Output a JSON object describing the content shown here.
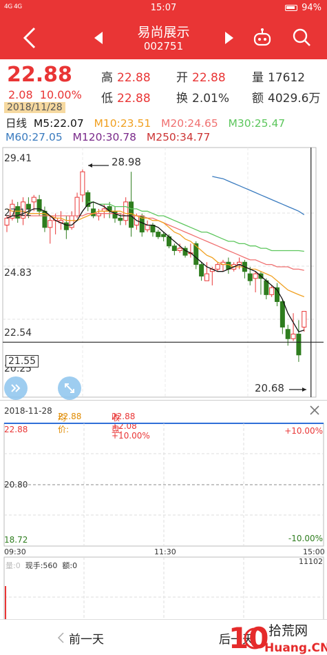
{
  "status": {
    "signal": "4G 4G",
    "time": "15:07",
    "battery": "94%"
  },
  "nav": {
    "title": "易尚展示",
    "code": "002751"
  },
  "quote": {
    "price": "22.88",
    "change": "2.08",
    "change_pct": "10.00%",
    "date": "2018/11/28",
    "high_label": "高",
    "high": "22.88",
    "open_label": "开",
    "open": "22.88",
    "vol_label": "量",
    "vol": "17612",
    "low_label": "低",
    "low": "22.88",
    "turnover_label": "换",
    "turnover": "2.01%",
    "amount_label": "额",
    "amount": "4029.6万"
  },
  "ma": {
    "period": "日线",
    "m5": "M5:22.07",
    "m10": "M10:23.51",
    "m20": "M20:24.65",
    "m30": "M30:25.47",
    "m60": "M60:27.05",
    "m120": "M120:30.78",
    "m250": "M250:34.77"
  },
  "colors": {
    "up": "#e93535",
    "down": "#2e7d1e",
    "m5": "#111111",
    "m10": "#f0a020",
    "m20": "#f07070",
    "m30": "#5cc65c",
    "m60": "#3a7bbf",
    "m120": "#7a2a8a",
    "m250": "#cc3333"
  },
  "kline": {
    "y_labels": [
      "29.41",
      "27.12",
      "24.83",
      "22.54",
      "20.25"
    ],
    "crosshair_value": "21.55",
    "max_label": "28.98",
    "min_label": "20.68",
    "candles": [
      [
        26.6,
        26.9,
        26.3,
        27.0
      ],
      [
        26.9,
        27.5,
        26.8,
        27.7
      ],
      [
        27.4,
        26.9,
        26.7,
        27.6
      ],
      [
        26.9,
        27.6,
        26.6,
        27.8
      ],
      [
        27.5,
        27.3,
        26.9,
        27.8
      ],
      [
        27.6,
        27.8,
        27.2,
        27.9
      ],
      [
        27.7,
        27.2,
        27.0,
        27.9
      ],
      [
        27.2,
        26.5,
        26.3,
        27.4
      ],
      [
        26.5,
        26.8,
        25.8,
        27.0
      ],
      [
        26.8,
        26.9,
        26.2,
        27.1
      ],
      [
        26.7,
        26.8,
        26.4,
        27.2
      ],
      [
        26.7,
        26.4,
        26.0,
        27.0
      ],
      [
        26.5,
        27.0,
        26.4,
        27.2
      ],
      [
        27.0,
        27.8,
        26.9,
        28.0
      ],
      [
        27.9,
        28.9,
        27.6,
        29.0
      ],
      [
        28.0,
        27.4,
        27.2,
        28.1
      ],
      [
        27.3,
        27.0,
        26.9,
        27.6
      ],
      [
        27.0,
        27.1,
        26.8,
        27.3
      ],
      [
        27.2,
        27.3,
        26.9,
        27.5
      ],
      [
        27.4,
        27.2,
        26.9,
        27.6
      ],
      [
        27.2,
        26.9,
        26.7,
        27.4
      ],
      [
        26.9,
        26.8,
        26.6,
        27.1
      ],
      [
        26.8,
        27.6,
        26.6,
        27.8
      ],
      [
        27.6,
        26.5,
        26.1,
        28.9
      ],
      [
        26.6,
        27.0,
        26.4,
        27.1
      ],
      [
        27.0,
        26.3,
        26.1,
        27.1
      ],
      [
        26.4,
        26.6,
        26.3,
        26.8
      ],
      [
        26.6,
        26.3,
        26.1,
        26.7
      ],
      [
        26.3,
        26.1,
        26.0,
        26.4
      ],
      [
        26.2,
        26.1,
        25.9,
        26.3
      ],
      [
        26.1,
        25.7,
        25.6,
        26.2
      ],
      [
        25.7,
        25.5,
        25.3,
        25.8
      ],
      [
        25.5,
        25.6,
        25.4,
        25.8
      ],
      [
        25.6,
        25.3,
        25.2,
        25.7
      ],
      [
        25.4,
        25.4,
        25.2,
        25.8
      ],
      [
        25.8,
        24.9,
        24.7,
        25.9
      ],
      [
        24.9,
        24.4,
        24.2,
        25.0
      ],
      [
        24.2,
        24.5,
        24.3,
        25.0
      ],
      [
        24.6,
        24.7,
        24.0,
        24.8
      ],
      [
        24.7,
        24.9,
        24.6,
        25.0
      ],
      [
        24.9,
        25.0,
        24.6,
        25.1
      ],
      [
        25.0,
        24.7,
        24.5,
        25.2
      ],
      [
        24.7,
        24.9,
        24.6,
        25.0
      ],
      [
        24.9,
        25.0,
        24.7,
        25.2
      ],
      [
        25.0,
        24.6,
        24.3,
        25.1
      ],
      [
        24.5,
        24.2,
        24.0,
        24.8
      ],
      [
        24.3,
        24.5,
        23.7,
        24.6
      ],
      [
        24.5,
        24.3,
        23.6,
        24.6
      ],
      [
        24.2,
        23.6,
        23.4,
        24.3
      ],
      [
        23.6,
        23.9,
        23.5,
        24.0
      ],
      [
        23.9,
        23.3,
        23.1,
        24.1
      ],
      [
        23.3,
        22.2,
        21.9,
        23.4
      ],
      [
        22.1,
        21.7,
        21.4,
        22.3
      ],
      [
        21.7,
        21.9,
        21.6,
        22.8
      ],
      [
        21.9,
        21.0,
        20.7,
        22.5
      ],
      [
        22.2,
        22.88,
        22.0,
        22.88
      ]
    ],
    "ma5": [
      26.9,
      27.0,
      27.0,
      27.1,
      27.2,
      27.3,
      27.3,
      27.2,
      27.0,
      26.8,
      26.7,
      26.6,
      26.6,
      26.8,
      27.2,
      27.5,
      27.6,
      27.5,
      27.4,
      27.2,
      27.1,
      27.0,
      27.0,
      27.0,
      26.8,
      26.7,
      26.6,
      26.6,
      26.5,
      26.3,
      26.1,
      25.9,
      25.7,
      25.5,
      25.4,
      25.2,
      25.0,
      24.8,
      24.7,
      24.6,
      24.6,
      24.7,
      24.8,
      24.9,
      24.8,
      24.7,
      24.6,
      24.4,
      24.2,
      24.0,
      23.8,
      23.4,
      22.8,
      22.4,
      22.0,
      22.07
    ],
    "ma10": [
      27.3,
      27.2,
      27.2,
      27.2,
      27.1,
      27.1,
      27.1,
      27.1,
      27.0,
      26.9,
      26.9,
      26.8,
      26.8,
      26.8,
      26.9,
      27.0,
      27.1,
      27.2,
      27.2,
      27.2,
      27.2,
      27.2,
      27.1,
      27.1,
      27.0,
      26.9,
      26.9,
      26.8,
      26.8,
      26.7,
      26.5,
      26.3,
      26.2,
      26.0,
      25.9,
      25.7,
      25.5,
      25.3,
      25.2,
      25.0,
      24.9,
      24.9,
      24.8,
      24.8,
      24.8,
      24.7,
      24.7,
      24.6,
      24.5,
      24.4,
      24.2,
      24.0,
      23.8,
      23.7,
      23.6,
      23.51
    ],
    "ma20": [
      27.0,
      27.0,
      27.0,
      27.0,
      27.0,
      27.0,
      27.0,
      27.0,
      27.0,
      27.0,
      27.0,
      27.0,
      27.0,
      27.0,
      27.0,
      27.1,
      27.1,
      27.1,
      27.1,
      27.1,
      27.1,
      27.1,
      27.0,
      27.0,
      27.0,
      27.0,
      26.9,
      26.9,
      26.8,
      26.7,
      26.6,
      26.5,
      26.4,
      26.3,
      26.2,
      26.1,
      26.0,
      25.9,
      25.8,
      25.7,
      25.6,
      25.5,
      25.4,
      25.3,
      25.2,
      25.1,
      25.1,
      25.0,
      24.9,
      24.9,
      24.8,
      24.8,
      24.8,
      24.7,
      24.7,
      24.65
    ],
    "ma30": [
      null,
      null,
      null,
      null,
      null,
      null,
      null,
      null,
      null,
      null,
      null,
      null,
      null,
      null,
      null,
      27.6,
      27.6,
      27.5,
      27.5,
      27.5,
      27.4,
      27.4,
      27.4,
      27.3,
      27.3,
      27.2,
      27.2,
      27.1,
      27.0,
      27.0,
      26.9,
      26.8,
      26.7,
      26.6,
      26.5,
      26.4,
      26.3,
      26.3,
      26.2,
      26.1,
      26.0,
      25.9,
      25.9,
      25.8,
      25.8,
      25.7,
      25.7,
      25.6,
      25.6,
      25.5,
      25.5,
      25.5,
      25.5,
      25.5,
      25.5,
      25.47
    ],
    "ma60": [
      null,
      null,
      null,
      null,
      null,
      null,
      null,
      null,
      null,
      null,
      null,
      null,
      null,
      null,
      null,
      null,
      null,
      null,
      null,
      null,
      null,
      null,
      null,
      null,
      null,
      null,
      null,
      null,
      null,
      null,
      null,
      null,
      null,
      null,
      null,
      null,
      null,
      null,
      28.7,
      28.65,
      28.6,
      28.5,
      28.4,
      28.3,
      28.2,
      28.1,
      28.0,
      27.9,
      27.8,
      27.7,
      27.6,
      27.5,
      27.4,
      27.3,
      27.2,
      27.05
    ]
  },
  "intraday": {
    "date": "2018-11-28",
    "avg_label": "均价:",
    "avg": "22.88",
    "close_label": "收盘:",
    "close_info": "22.88 +2.08 +10.00%",
    "top_price": "22.88",
    "mid_price": "20.80",
    "bottom_price": "18.72",
    "top_pct": "+10.00%",
    "bottom_pct": "-10.00%",
    "t_start": "09:30",
    "t_mid": "11:30",
    "t_end": "15:00",
    "vol_max": "11102",
    "vol_info_prefix": "量:0",
    "vol_now_label": "现手:560",
    "amount_label": "额:0"
  },
  "bottom": {
    "prev_day": "前一天",
    "next_day": "后一天"
  },
  "watermark": {
    "number": "10",
    "text": "拾荒网",
    "domain": "Huang.CN"
  }
}
